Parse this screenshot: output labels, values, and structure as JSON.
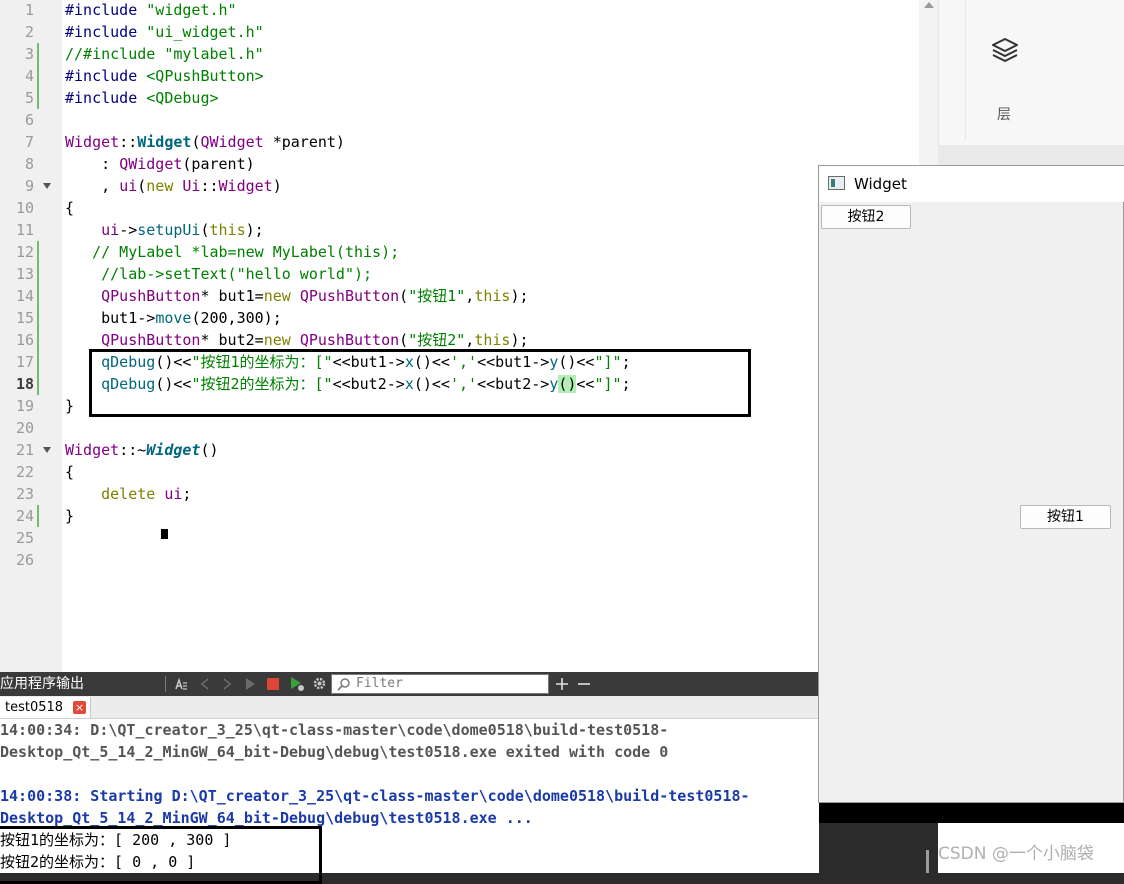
{
  "editor": {
    "lines": [
      {
        "n": "1",
        "segs": [
          {
            "c": "pp",
            "t": "#include "
          },
          {
            "c": "str",
            "t": "\"widget.h\""
          }
        ]
      },
      {
        "n": "2",
        "segs": [
          {
            "c": "pp",
            "t": "#include "
          },
          {
            "c": "str",
            "t": "\"ui_widget.h\""
          }
        ]
      },
      {
        "n": "3",
        "segs": [
          {
            "c": "cm",
            "t": "//#include \"mylabel.h\""
          }
        ]
      },
      {
        "n": "4",
        "segs": [
          {
            "c": "pp",
            "t": "#include "
          },
          {
            "c": "str",
            "t": "<QPushButton>"
          }
        ]
      },
      {
        "n": "5",
        "segs": [
          {
            "c": "pp",
            "t": "#include "
          },
          {
            "c": "str",
            "t": "<QDebug>"
          }
        ]
      },
      {
        "n": "6",
        "segs": []
      },
      {
        "n": "7",
        "segs": [
          {
            "c": "cls",
            "t": "Widget"
          },
          {
            "c": "",
            "t": "::"
          },
          {
            "c": "fnb",
            "t": "Widget"
          },
          {
            "c": "",
            "t": "("
          },
          {
            "c": "cls",
            "t": "QWidget"
          },
          {
            "c": "",
            "t": " *parent)"
          }
        ]
      },
      {
        "n": "8",
        "segs": [
          {
            "c": "",
            "t": "    : "
          },
          {
            "c": "cls",
            "t": "QWidget"
          },
          {
            "c": "",
            "t": "(parent)"
          }
        ]
      },
      {
        "n": "9",
        "segs": [
          {
            "c": "",
            "t": "    , "
          },
          {
            "c": "cls",
            "t": "ui"
          },
          {
            "c": "",
            "t": "("
          },
          {
            "c": "kw",
            "t": "new"
          },
          {
            "c": "",
            "t": " "
          },
          {
            "c": "cls",
            "t": "Ui"
          },
          {
            "c": "",
            "t": "::"
          },
          {
            "c": "cls",
            "t": "Widget"
          },
          {
            "c": "",
            "t": ")"
          }
        ]
      },
      {
        "n": "10",
        "segs": [
          {
            "c": "",
            "t": "{"
          }
        ]
      },
      {
        "n": "11",
        "segs": [
          {
            "c": "",
            "t": "    "
          },
          {
            "c": "cls",
            "t": "ui"
          },
          {
            "c": "",
            "t": "->"
          },
          {
            "c": "fn",
            "t": "setupUi"
          },
          {
            "c": "",
            "t": "("
          },
          {
            "c": "kw",
            "t": "this"
          },
          {
            "c": "",
            "t": ");"
          }
        ]
      },
      {
        "n": "12",
        "segs": [
          {
            "c": "cm",
            "t": "   // MyLabel *lab=new MyLabel(this);"
          }
        ]
      },
      {
        "n": "13",
        "segs": [
          {
            "c": "cm",
            "t": "    //lab->setText(\"hello world\");"
          }
        ]
      },
      {
        "n": "14",
        "segs": [
          {
            "c": "",
            "t": "    "
          },
          {
            "c": "cls",
            "t": "QPushButton"
          },
          {
            "c": "",
            "t": "* but1="
          },
          {
            "c": "kw",
            "t": "new"
          },
          {
            "c": "",
            "t": " "
          },
          {
            "c": "cls",
            "t": "QPushButton"
          },
          {
            "c": "",
            "t": "("
          },
          {
            "c": "str",
            "t": "\"按钮1\""
          },
          {
            "c": "",
            "t": ","
          },
          {
            "c": "kw",
            "t": "this"
          },
          {
            "c": "",
            "t": ");"
          }
        ]
      },
      {
        "n": "15",
        "segs": [
          {
            "c": "",
            "t": "    but1->"
          },
          {
            "c": "fn",
            "t": "move"
          },
          {
            "c": "",
            "t": "(200,300);"
          }
        ]
      },
      {
        "n": "16",
        "segs": [
          {
            "c": "",
            "t": "    "
          },
          {
            "c": "cls",
            "t": "QPushButton"
          },
          {
            "c": "",
            "t": "* but2="
          },
          {
            "c": "kw",
            "t": "new"
          },
          {
            "c": "",
            "t": " "
          },
          {
            "c": "cls",
            "t": "QPushButton"
          },
          {
            "c": "",
            "t": "("
          },
          {
            "c": "str",
            "t": "\"按钮2\""
          },
          {
            "c": "",
            "t": ","
          },
          {
            "c": "kw",
            "t": "this"
          },
          {
            "c": "",
            "t": ");"
          }
        ]
      },
      {
        "n": "17",
        "segs": [
          {
            "c": "",
            "t": "    "
          },
          {
            "c": "fn",
            "t": "qDebug"
          },
          {
            "c": "",
            "t": "()<<"
          },
          {
            "c": "str",
            "t": "\"按钮1的坐标为：[\""
          },
          {
            "c": "",
            "t": "<<but1->"
          },
          {
            "c": "fn",
            "t": "x"
          },
          {
            "c": "",
            "t": "()<<"
          },
          {
            "c": "str",
            "t": "','"
          },
          {
            "c": "",
            "t": "<<but1->"
          },
          {
            "c": "fn",
            "t": "y"
          },
          {
            "c": "",
            "t": "()<<"
          },
          {
            "c": "str",
            "t": "\"]\""
          },
          {
            "c": "",
            "t": ";"
          }
        ]
      },
      {
        "n": "18",
        "cur": true,
        "segs": [
          {
            "c": "",
            "t": "    "
          },
          {
            "c": "fn",
            "t": "qDebug"
          },
          {
            "c": "",
            "t": "()<<"
          },
          {
            "c": "str",
            "t": "\"按钮2的坐标为：[\""
          },
          {
            "c": "",
            "t": "<<but2->"
          },
          {
            "c": "fn",
            "t": "x"
          },
          {
            "c": "",
            "t": "()<<"
          },
          {
            "c": "str",
            "t": "','"
          },
          {
            "c": "",
            "t": "<<but2->"
          },
          {
            "c": "fn",
            "t": "y"
          },
          {
            "c": "paren-hl",
            "t": "()"
          },
          {
            "c": "",
            "t": "<<"
          },
          {
            "c": "str",
            "t": "\"]\""
          },
          {
            "c": "",
            "t": ";"
          }
        ]
      },
      {
        "n": "19",
        "segs": [
          {
            "c": "",
            "t": "}"
          }
        ]
      },
      {
        "n": "20",
        "segs": []
      },
      {
        "n": "21",
        "segs": [
          {
            "c": "cls",
            "t": "Widget"
          },
          {
            "c": "",
            "t": "::~"
          },
          {
            "c": "fni",
            "t": "Widget"
          },
          {
            "c": "",
            "t": "()"
          }
        ]
      },
      {
        "n": "22",
        "segs": [
          {
            "c": "",
            "t": "{"
          }
        ]
      },
      {
        "n": "23",
        "segs": [
          {
            "c": "",
            "t": "    "
          },
          {
            "c": "kw",
            "t": "delete"
          },
          {
            "c": "",
            "t": " "
          },
          {
            "c": "cls",
            "t": "ui"
          },
          {
            "c": "",
            "t": ";"
          }
        ]
      },
      {
        "n": "24",
        "segs": [
          {
            "c": "",
            "t": "}"
          }
        ]
      },
      {
        "n": "25",
        "segs": []
      },
      {
        "n": "26",
        "segs": []
      }
    ],
    "changed_lines": [
      "3",
      "4",
      "5",
      "12",
      "13",
      "14",
      "15",
      "16",
      "17",
      "18",
      "24"
    ],
    "fold_lines": [
      "9",
      "21"
    ]
  },
  "right_panel": {
    "layers_label": "层"
  },
  "output_pane": {
    "title": "应用程序输出",
    "filter_placeholder": "Filter",
    "tab_label": "test0518",
    "tab_close": "×",
    "lines": [
      {
        "style": "gray",
        "t": "14:00:34: D:\\QT_creator_3_25\\qt-class-master\\code\\dome0518\\build-test0518-"
      },
      {
        "style": "gray",
        "t": "Desktop_Qt_5_14_2_MinGW_64_bit-Debug\\debug\\test0518.exe exited with code 0"
      },
      {
        "style": "gray",
        "t": ""
      },
      {
        "style": "blue",
        "t": "14:00:38: Starting D:\\QT_creator_3_25\\qt-class-master\\code\\dome0518\\build-test0518-"
      },
      {
        "style": "blue",
        "t": "Desktop_Qt_5_14_2_MinGW_64_bit-Debug\\debug\\test0518.exe ..."
      },
      {
        "style": "plain",
        "t": "按钮1的坐标为：[ 200 , 300 ]"
      },
      {
        "style": "plain",
        "t": "按钮2的坐标为：[ 0 , 0 ]"
      }
    ]
  },
  "widget_window": {
    "title": "Widget",
    "button2_label": "按钮2",
    "button1_label": "按钮1"
  },
  "watermark": "CSDN @一个小脑袋",
  "colors": {
    "changed_marker": "#6fbe6f",
    "stop_icon": "#e0453a",
    "run_icon": "#3aa23a"
  }
}
